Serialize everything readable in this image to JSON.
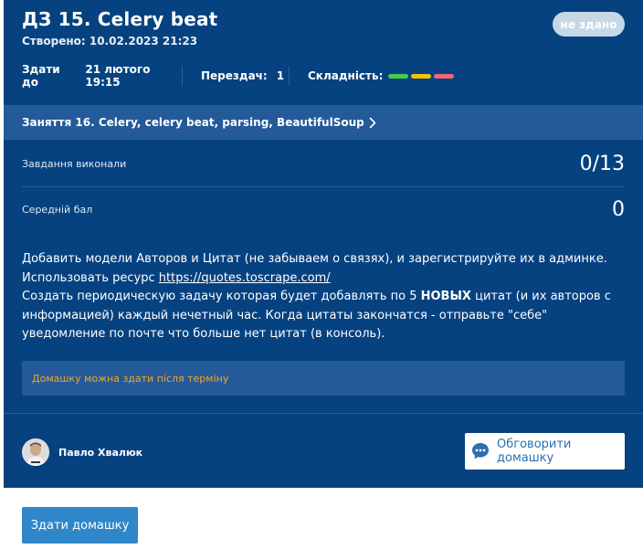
{
  "header": {
    "title": "ДЗ 15. Celery beat",
    "created": "Створено: 10.02.2023 21:23",
    "status": "не здано"
  },
  "meta": {
    "deadline_label": "Здати до",
    "deadline_value": "21 лютого 19:15",
    "retakes_label": "Перездач:",
    "retakes_value": "1",
    "difficulty_label": "Складність:",
    "difficulty_colors": [
      "#3ecf4a",
      "#f5c400",
      "#f2667a"
    ]
  },
  "lesson": {
    "label": "Заняття 16. Celery, celery beat, parsing, BeautifulSoup"
  },
  "stats": {
    "completed_label": "Завдання виконали",
    "completed_value": "0/13",
    "avg_label": "Середній бал",
    "avg_value": "0"
  },
  "description": {
    "line1": "Добавить модели Авторов и Цитат (не забываем о связях), и зарегистрируйте их в админке.",
    "line2_prefix": "Использовать ресурс ",
    "link": "https://quotes.toscrape.com/",
    "line3_prefix": "Создать периодическую задачу которая будет добавлять по 5 ",
    "line3_bold": "НОВЫХ",
    "line3_suffix": " цитат (и их авторов с информацией) каждый нечетный час. Когда цитаты закончатся - отправьте \"себе\" уведомление по почте что больше нет цитат (в консоль)."
  },
  "notice": "Домашку можна здати після терміну",
  "author": {
    "name": "Павло Хвалюк"
  },
  "buttons": {
    "discuss": "Обговорити домашку",
    "submit": "Здати домашку"
  },
  "colors": {
    "card_bg": "#064280",
    "accent": "#2f86c9",
    "notice_text": "#f5a623"
  }
}
